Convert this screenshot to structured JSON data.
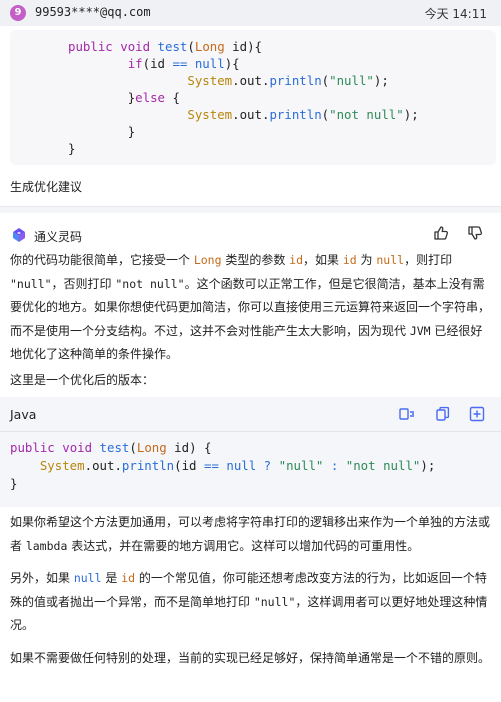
{
  "user": {
    "avatar_letter": "9",
    "username": "99593****@qq.com",
    "timestamp": "今天 14:11",
    "request": "生成优化建议",
    "code": {
      "line1": {
        "indent": "",
        "kw1": "public",
        "sp1": " ",
        "kw2": "void",
        "sp2": " ",
        "fn": "test",
        "p1": "(",
        "ty": "Long",
        "rest": " id){"
      },
      "line2": {
        "indent": "        ",
        "kw": "if",
        "p1": "(id ",
        "op": "==",
        "sp": " ",
        "kw2": "null",
        "rest": "){"
      },
      "line3": {
        "indent": "                ",
        "cls": "System",
        "mid": ".out.",
        "fn": "println",
        "p1": "(",
        "str": "\"null\"",
        "rest": ");"
      },
      "line4": {
        "indent": "        ",
        "p1": "}",
        "kw": "else",
        "rest": " {"
      },
      "line5": {
        "indent": "                ",
        "cls": "System",
        "mid": ".out.",
        "fn": "println",
        "p1": "(",
        "str": "\"not null\"",
        "rest": ");"
      },
      "line6": {
        "indent": "        ",
        "rest": "}"
      },
      "line7": {
        "indent": "",
        "rest": "}"
      }
    }
  },
  "assistant": {
    "name": "通义灵码",
    "para1": {
      "t1": "你的代码功能很简单，它接受一个 ",
      "c1": "Long",
      "t2": " 类型的参数 ",
      "c2": "id",
      "t3": "，如果 ",
      "c3": "id",
      "t4": " 为 ",
      "c4": "null",
      "t5": "，则打印 ",
      "c5": "\"null\"",
      "t6": "，否则打印 ",
      "c6": "\"not null\"",
      "t7": "。这个函数可以正常工作，但是它很简洁，基本上没有需要优化的地方。如果你想使代码更加简洁，你可以直接使用三元运算符来返回一个字符串，而不是使用一个分支结构。不过，这并不会对性能产生太大影响，因为现代 ",
      "c7": "JVM",
      "t8": " 已经很好地优化了这种简单的条件操作。"
    },
    "para2": "这里是一个优化后的版本：",
    "code_lang": "Java",
    "code": {
      "line1": {
        "kw1": "public",
        "sp1": " ",
        "kw2": "void",
        "sp2": " ",
        "fn": "test",
        "p1": "(",
        "ty": "Long",
        "rest": " id) {"
      },
      "line2": {
        "indent": "    ",
        "cls": "System",
        "mid": ".out.",
        "fn": "println",
        "p1": "(id ",
        "op": "==",
        "sp": " ",
        "kw": "null",
        "q": " ? ",
        "s1": "\"null\"",
        "colon": " : ",
        "s2": "\"not null\"",
        "rest": ");"
      },
      "line3": {
        "rest": "}"
      }
    },
    "para3": {
      "t1": "如果你希望这个方法更加通用，可以考虑将字符串打印的逻辑移出来作为一个单独的方法或者 ",
      "c1": "lambda",
      "t2": " 表达式，并在需要的地方调用它。这样可以增加代码的可重用性。"
    },
    "para4": {
      "t1": "另外，如果 ",
      "c1": "null",
      "t2": " 是 ",
      "c2": "id",
      "t3": " 的一个常见值，你可能还想考虑改变方法的行为，比如返回一个特殊的值或者抛出一个异常，而不是简单地打印 ",
      "c3": "\"null\"",
      "t4": "，这样调用者可以更好地处理这种情况。"
    },
    "para5": "如果不需要做任何特别的处理，当前的实现已经足够好，保持简单通常是一个不错的原则。"
  },
  "icons": {
    "logo": "tongyi-logo-icon",
    "like": "thumbs-up-icon",
    "dislike": "thumbs-down-icon",
    "insert": "insert-at-cursor-icon",
    "copy": "copy-icon",
    "new_file": "new-file-icon"
  },
  "colors": {
    "accent": "#4a6bf2",
    "keyword": "#a329a8",
    "function": "#2a6dd8",
    "type": "#c46a1a",
    "string": "#2e8b57",
    "avatar": "#c35fc6"
  }
}
